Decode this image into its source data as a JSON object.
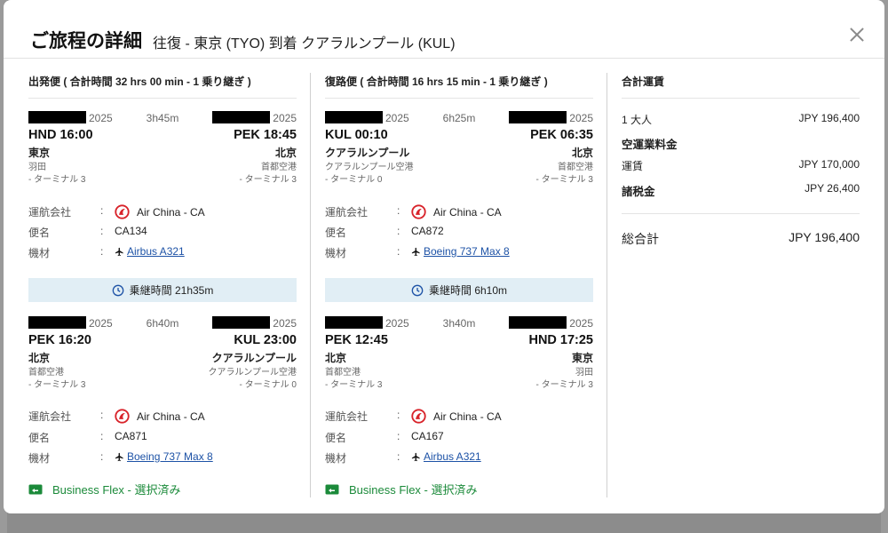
{
  "header": {
    "title": "ご旅程の詳細",
    "subtitle": "往復 - 東京 (TYO) 到着 クアラルンプール (KUL)"
  },
  "outbound": {
    "heading": "出発便 ( 合計時間 32 hrs 00 min - 1 乗り継ぎ )",
    "segments": [
      {
        "dep_year": "2025",
        "duration": "3h45m",
        "arr_year": "2025",
        "dep": "HND 16:00",
        "arr": "PEK 18:45",
        "dep_city": "東京",
        "arr_city": "北京",
        "dep_airport": "羽田",
        "arr_airport": "首都空港",
        "dep_terminal": "- ターミナル 3",
        "arr_terminal": "- ターミナル 3",
        "carrier_label": "運航会社",
        "carrier": "Air China - CA",
        "flight_label": "便名",
        "flight": "CA134",
        "aircraft_label": "機材",
        "aircraft": "Airbus A321",
        "sep": ":"
      },
      {
        "dep_year": "2025",
        "duration": "6h40m",
        "arr_year": "2025",
        "dep": "PEK 16:20",
        "arr": "KUL 23:00",
        "dep_city": "北京",
        "arr_city": "クアラルンプール",
        "dep_airport": "首都空港",
        "arr_airport": "クアラルンプール空港",
        "dep_terminal": "- ターミナル 3",
        "arr_terminal": "- ターミナル 0",
        "carrier_label": "運航会社",
        "carrier": "Air China - CA",
        "flight_label": "便名",
        "flight": "CA871",
        "aircraft_label": "機材",
        "aircraft": "Boeing 737 Max 8",
        "sep": ":"
      }
    ],
    "layover": "乗継時間 21h35m",
    "fare": "Business Flex - 選択済み"
  },
  "return": {
    "heading": "復路便 ( 合計時間 16 hrs 15 min - 1 乗り継ぎ )",
    "segments": [
      {
        "dep_year": "2025",
        "duration": "6h25m",
        "arr_year": "2025",
        "dep": "KUL 00:10",
        "arr": "PEK 06:35",
        "dep_city": "クアラルンプール",
        "arr_city": "北京",
        "dep_airport": "クアラルンプール空港",
        "arr_airport": "首都空港",
        "dep_terminal": "- ターミナル 0",
        "arr_terminal": "- ターミナル 3",
        "carrier_label": "運航会社",
        "carrier": "Air China - CA",
        "flight_label": "便名",
        "flight": "CA872",
        "aircraft_label": "機材",
        "aircraft": "Boeing 737 Max 8",
        "sep": ":"
      },
      {
        "dep_year": "2025",
        "duration": "3h40m",
        "arr_year": "2025",
        "dep": "PEK 12:45",
        "arr": "HND 17:25",
        "dep_city": "北京",
        "arr_city": "東京",
        "dep_airport": "首都空港",
        "arr_airport": "羽田",
        "dep_terminal": "- ターミナル 3",
        "arr_terminal": "- ターミナル 3",
        "carrier_label": "運航会社",
        "carrier": "Air China - CA",
        "flight_label": "便名",
        "flight": "CA167",
        "aircraft_label": "機材",
        "aircraft": "Airbus A321",
        "sep": ":"
      }
    ],
    "layover": "乗継時間 6h10m",
    "fare": "Business Flex - 選択済み"
  },
  "summary": {
    "heading": "合計運賃",
    "adult_label": "1 大人",
    "adult_value": "JPY 196,400",
    "airfare_heading": "空運業料金",
    "fare_label": "運賃",
    "fare_value": "JPY 170,000",
    "tax_label": "諸税金",
    "tax_value": "JPY 26,400",
    "total_label": "総合計",
    "total_value": "JPY 196,400"
  },
  "colors": {
    "accent_green": "#1b8a3a",
    "link_blue": "#1d52a6",
    "layover_bg": "#e1eef5",
    "airline_red": "#d8232a"
  },
  "icons": {
    "close": "close-icon",
    "airline": "air-china-logo",
    "aircraft": "plane-icon",
    "layover": "clock-icon",
    "fare": "ticket-icon"
  }
}
